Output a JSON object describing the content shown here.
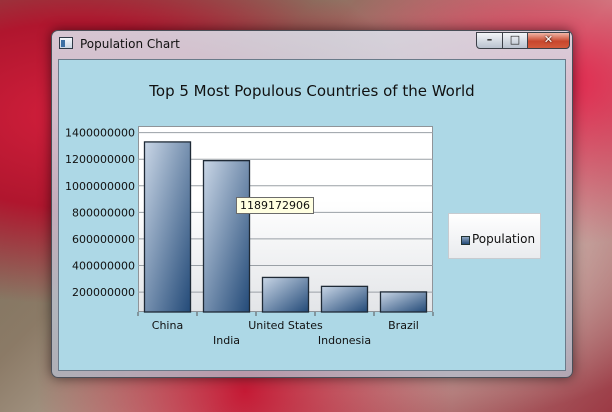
{
  "window": {
    "title": "Population Chart",
    "icon": "window-app-icon"
  },
  "controls": {
    "minimize": "minimize-icon",
    "maximize": "maximize-icon",
    "close": "close-icon"
  },
  "tooltip": {
    "text": "1189172906"
  },
  "legend": {
    "label": "Population"
  },
  "colors": {
    "client_bg": "#add8e6",
    "bar_dark": "#234a78",
    "bar_light": "#c9d6e6"
  },
  "chart_data": {
    "type": "bar",
    "title": "Top 5 Most Populous Countries of the World",
    "categories": [
      "China",
      "India",
      "United States",
      "Indonesia",
      "Brazil"
    ],
    "series": [
      {
        "name": "Population",
        "values": [
          1330141295,
          1189172906,
          310232863,
          242968342,
          201103330
        ]
      }
    ],
    "yticks": [
      "200000000",
      "400000000",
      "600000000",
      "800000000",
      "1000000000",
      "1200000000",
      "1400000000"
    ],
    "ylim": [
      50000000,
      1450000000
    ],
    "grid": true,
    "legend_position": "right"
  }
}
